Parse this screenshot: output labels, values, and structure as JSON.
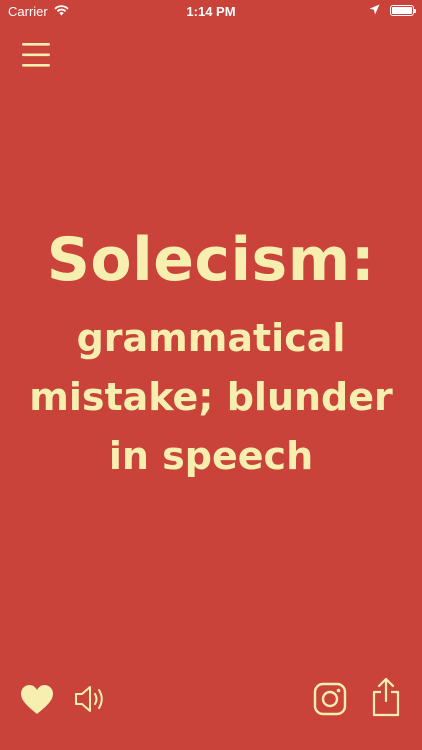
{
  "status_bar": {
    "carrier": "Carrier",
    "time": "1:14 PM",
    "battery_level": 1.0
  },
  "card": {
    "word": "Solecism:",
    "definition": "grammatical mistake; blunder in speech"
  },
  "colors": {
    "background": "#C9433A",
    "text": "#F7EFB0",
    "status_text": "#FFFFFF"
  },
  "icons": {
    "menu": "hamburger-menu-icon",
    "favorite": "heart-icon",
    "audio": "speaker-icon",
    "instagram": "instagram-icon",
    "share": "share-icon"
  }
}
